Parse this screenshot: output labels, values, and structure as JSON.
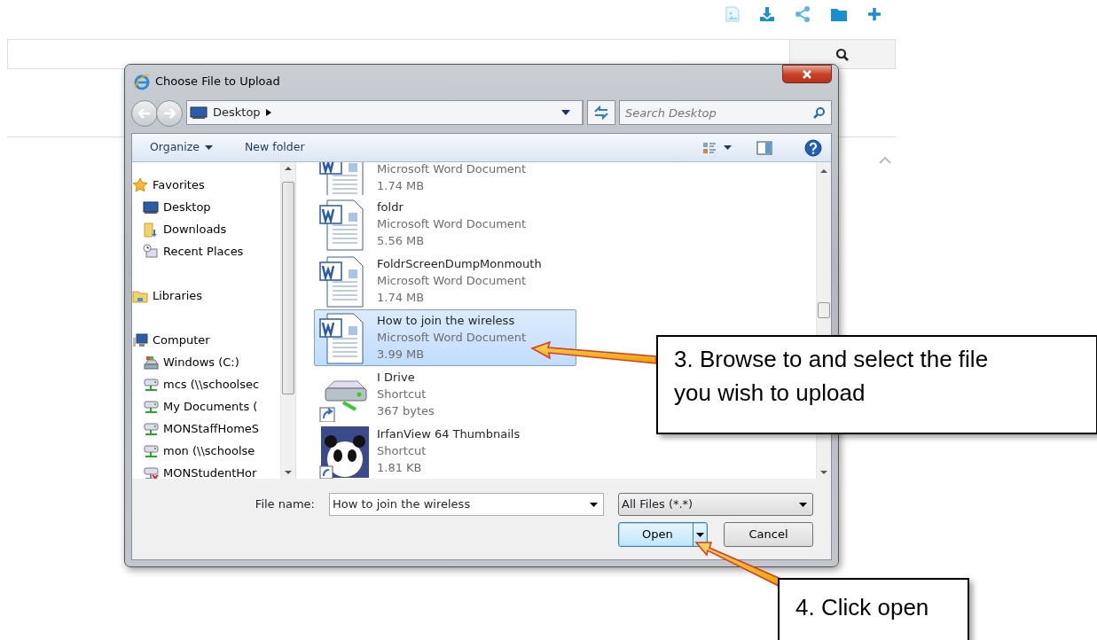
{
  "dialog": {
    "title": "Choose File to Upload",
    "address": "Desktop",
    "search_placeholder": "Search Desktop",
    "toolbar": [
      "Organize",
      "New folder"
    ],
    "nav": [
      {
        "label": "Favorites",
        "kind": "favorites",
        "children": [
          {
            "label": "Desktop",
            "kind": "desktop"
          },
          {
            "label": "Downloads",
            "kind": "downloads"
          },
          {
            "label": "Recent Places",
            "kind": "recent"
          }
        ]
      },
      {
        "label": "Libraries",
        "kind": "libraries"
      },
      {
        "label": "Computer",
        "kind": "computer",
        "children": [
          {
            "label": "Windows (C:)",
            "kind": "drive"
          },
          {
            "label": "mcs (\\\\schoolsec",
            "kind": "network"
          },
          {
            "label": "My Documents (",
            "kind": "network"
          },
          {
            "label": "MONStaffHomeS",
            "kind": "network"
          },
          {
            "label": "mon (\\\\schoolse",
            "kind": "network"
          },
          {
            "label": "MONStudentHor",
            "kind": "offline"
          }
        ]
      }
    ],
    "files": [
      {
        "kind": "word",
        "type": "Microsoft Word Document",
        "size": "1.74 MB",
        "selected": false
      },
      {
        "kind": "word",
        "name": "foldr",
        "type": "Microsoft Word Document",
        "size": "5.56 MB",
        "selected": false
      },
      {
        "kind": "word",
        "name": "FoldrScreenDumpMonmouth",
        "type": "Microsoft Word Document",
        "size": "1.74 MB",
        "selected": false
      },
      {
        "kind": "word",
        "name": "How to join the wireless",
        "type": "Microsoft Word Document",
        "size": "3.99 MB",
        "selected": true
      },
      {
        "kind": "drive",
        "name": "I Drive",
        "type": "Shortcut",
        "size": "367 bytes",
        "selected": false
      },
      {
        "kind": "image",
        "name": "IrfanView 64 Thumbnails",
        "type": "Shortcut",
        "size": "1.81 KB",
        "selected": false
      }
    ],
    "file_name_label": "File name:",
    "file_name": "How to join the wireless",
    "file_type": "All Files (*.*)",
    "buttons": [
      "Open",
      "Cancel"
    ]
  },
  "callouts": [
    "3. Browse to and select the file you wish to upload",
    "4. Click open"
  ]
}
